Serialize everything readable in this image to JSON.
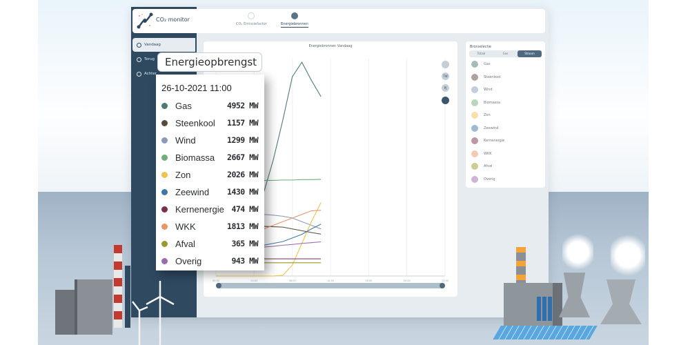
{
  "app": {
    "brand": "CO₂ monitor"
  },
  "nav": {
    "tabs": [
      {
        "label": "CO₂ Emissiefactor",
        "active": false
      },
      {
        "label": "Energiebronnen",
        "active": true
      }
    ]
  },
  "sidebar": {
    "items": [
      {
        "label": "Vandaag",
        "active": true
      },
      {
        "label": "Terug"
      },
      {
        "label": "Achter"
      }
    ]
  },
  "chart_card": {
    "title": "Energiebronnen Vandaag",
    "buttons": [
      "",
      "TW",
      "PJ",
      ""
    ]
  },
  "panel": {
    "title": "Bronselectie",
    "segments": [
      {
        "label": "Totaal"
      },
      {
        "label": "Gas"
      },
      {
        "label": "Stroom",
        "active": true
      }
    ],
    "sources": [
      {
        "label": "Gas",
        "color": "#4c7a78"
      },
      {
        "label": "Steenkool",
        "color": "#5a4a3a"
      },
      {
        "label": "Wind",
        "color": "#8c9ab5"
      },
      {
        "label": "Biomassa",
        "color": "#6fae7a"
      },
      {
        "label": "Zon",
        "color": "#f2c14e"
      },
      {
        "label": "Zeewind",
        "color": "#3f78a8"
      },
      {
        "label": "Kernenergie",
        "color": "#7b2f4f"
      },
      {
        "label": "WKK",
        "color": "#e8956a"
      },
      {
        "label": "Afval",
        "color": "#9a9a2e"
      },
      {
        "label": "Overig",
        "color": "#9b6bb0"
      }
    ]
  },
  "tooltip": {
    "title": "Energieopbrengst",
    "datetime": "26-10-2021 11:00",
    "rows": [
      {
        "label": "Gas",
        "value": "4952 MW"
      },
      {
        "label": "Steenkool",
        "value": "1157 MW"
      },
      {
        "label": "Wind",
        "value": "1299 MW"
      },
      {
        "label": "Biomassa",
        "value": "2667 MW"
      },
      {
        "label": "Zon",
        "value": "2026 MW"
      },
      {
        "label": "Zeewind",
        "value": "1430 MW"
      },
      {
        "label": "Kernenergie",
        "value": "474 MW"
      },
      {
        "label": "WKK",
        "value": "1813 MW"
      },
      {
        "label": "Afval",
        "value": "365 MW"
      },
      {
        "label": "Overig",
        "value": "943 MW"
      }
    ]
  },
  "chart_data": {
    "type": "line",
    "title": "Energiebronnen Vandaag",
    "ylabel": "MW",
    "x": [
      0,
      1,
      2,
      3,
      4,
      5,
      6,
      7,
      8,
      9,
      10,
      11
    ],
    "xlim": [
      0,
      24
    ],
    "ylim": [
      0,
      6000
    ],
    "xticks": [
      "00:00",
      "04:00",
      "08:00",
      "12:00",
      "16:00",
      "20:00",
      "24:00"
    ],
    "grid": true,
    "series": [
      {
        "name": "Gas",
        "color": "#4c7a78",
        "values": [
          1800,
          1750,
          1700,
          1750,
          1900,
          2300,
          3200,
          4300,
          5500,
          5900,
          5400,
          4952
        ]
      },
      {
        "name": "Steenkool",
        "color": "#5a4a3a",
        "values": [
          1400,
          1400,
          1390,
          1380,
          1380,
          1370,
          1360,
          1350,
          1300,
          1250,
          1200,
          1157
        ]
      },
      {
        "name": "Wind",
        "color": "#8c9ab5",
        "values": [
          1800,
          1780,
          1760,
          1740,
          1720,
          1700,
          1680,
          1650,
          1600,
          1500,
          1400,
          1299
        ]
      },
      {
        "name": "Biomassa",
        "color": "#6fae7a",
        "values": [
          2600,
          2610,
          2620,
          2620,
          2630,
          2640,
          2640,
          2650,
          2650,
          2660,
          2660,
          2667
        ]
      },
      {
        "name": "Zon",
        "color": "#f2c14e",
        "values": [
          0,
          0,
          0,
          0,
          0,
          0,
          0,
          20,
          300,
          900,
          1500,
          2026
        ]
      },
      {
        "name": "Zeewind",
        "color": "#3f78a8",
        "values": [
          600,
          650,
          700,
          750,
          800,
          850,
          900,
          950,
          1050,
          1150,
          1300,
          1430
        ]
      },
      {
        "name": "Kernenergie",
        "color": "#7b2f4f",
        "values": [
          474,
          474,
          474,
          474,
          474,
          474,
          474,
          474,
          474,
          474,
          474,
          474
        ]
      },
      {
        "name": "WKK",
        "color": "#e8956a",
        "values": [
          1100,
          1100,
          1100,
          1150,
          1200,
          1300,
          1400,
          1500,
          1600,
          1700,
          1800,
          1813
        ]
      },
      {
        "name": "Afval",
        "color": "#9a9a2e",
        "values": [
          365,
          365,
          365,
          365,
          365,
          365,
          365,
          365,
          365,
          365,
          365,
          365
        ]
      },
      {
        "name": "Overig",
        "color": "#9b6bb0",
        "values": [
          700,
          720,
          740,
          760,
          780,
          800,
          820,
          850,
          870,
          900,
          920,
          943
        ]
      }
    ]
  }
}
